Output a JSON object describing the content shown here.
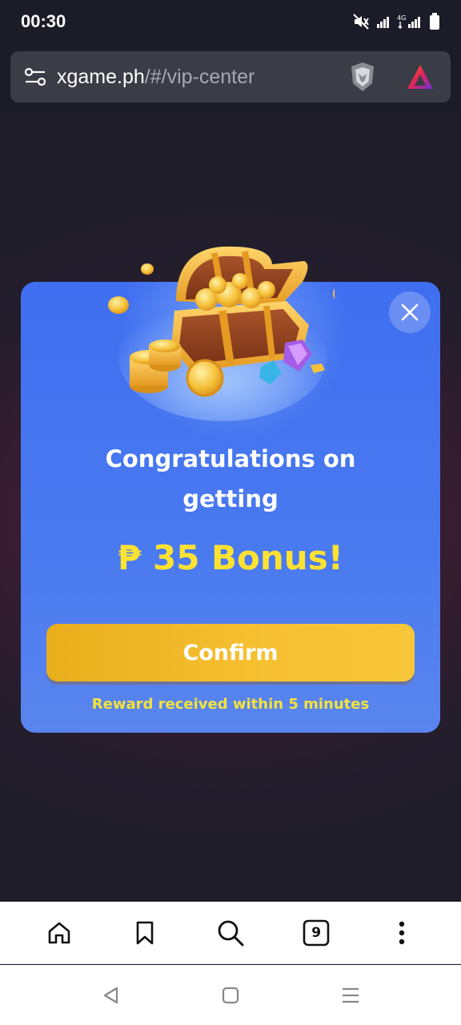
{
  "status_bar": {
    "time": "00:30",
    "icons": [
      "mute-icon",
      "signal-icon",
      "4g-signal-icon",
      "battery-icon"
    ]
  },
  "browser": {
    "url_domain": "xgame.ph",
    "url_path": "/#/vip-center",
    "icons": [
      "site-settings-icon",
      "brave-shield-icon",
      "brave-rewards-icon"
    ]
  },
  "modal": {
    "title": "Congratulations on getting",
    "bonus": "₱ 35 Bonus!",
    "confirm_label": "Confirm",
    "note": "Reward received within 5 minutes",
    "icons": [
      "close-icon",
      "treasure-chest-icon"
    ]
  },
  "toolbar": {
    "tab_count": "9",
    "icons": [
      "home-icon",
      "bookmark-icon",
      "search-icon",
      "tabs-icon",
      "more-icon"
    ]
  },
  "nav": {
    "icons": [
      "back-icon",
      "home-nav-icon",
      "recents-icon"
    ]
  },
  "colors": {
    "modal_blue": "#4474f0",
    "bonus_yellow": "#fde232",
    "confirm_gold": "#f2b92a",
    "note_yellow": "#f4e23a"
  }
}
